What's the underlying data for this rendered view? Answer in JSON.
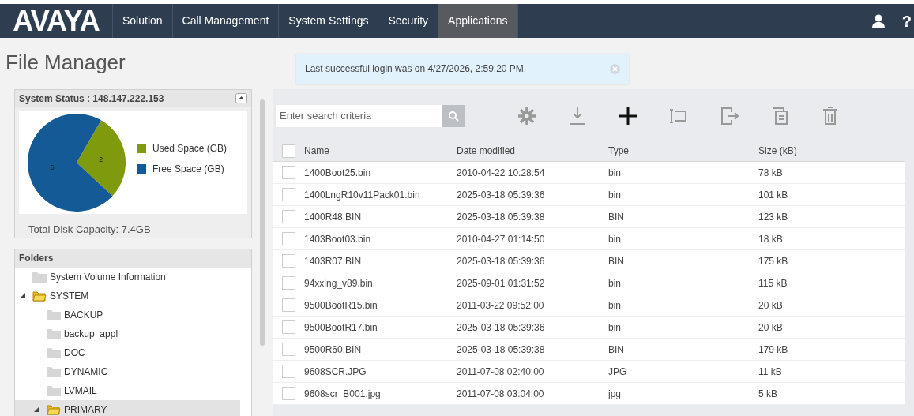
{
  "nav": {
    "logo": "AVAYA",
    "items": [
      {
        "label": "Solution",
        "selected": false
      },
      {
        "label": "Call Management",
        "selected": false
      },
      {
        "label": "System Settings",
        "selected": false
      },
      {
        "label": "Security",
        "selected": false
      },
      {
        "label": "Applications",
        "selected": true
      }
    ],
    "help": "?"
  },
  "page_title": "File Manager",
  "notification": "Last successful login was on 4/27/2026, 2:59:20 PM.",
  "status_panel": {
    "title": "System Status : 148.147.222.153",
    "legend": [
      {
        "color": "#7f9a0c"
      },
      {
        "color": "#135a96"
      }
    ],
    "chart_data": {
      "type": "pie",
      "categories": [
        "Used Space (GB)",
        "Free Space (GB)"
      ],
      "values": [
        2,
        5
      ],
      "data_labels": true
    },
    "total": "Total Disk Capacity: 7.4GB"
  },
  "folders": {
    "title": "Folders",
    "tree": [
      {
        "name": "System Volume Information",
        "expanded": false,
        "selected": false
      },
      {
        "name": "SYSTEM",
        "expanded": true,
        "selected": false,
        "children": [
          {
            "name": "BACKUP",
            "expanded": false,
            "selected": false
          },
          {
            "name": "backup_appl",
            "expanded": false,
            "selected": false
          },
          {
            "name": "DOC",
            "expanded": false,
            "selected": false
          },
          {
            "name": "DYNAMIC",
            "expanded": false,
            "selected": false
          },
          {
            "name": "LVMAIL",
            "expanded": false,
            "selected": false
          },
          {
            "name": "PRIMARY",
            "expanded": true,
            "selected": true
          }
        ]
      }
    ]
  },
  "search": {
    "placeholder": "Enter search criteria"
  },
  "table": {
    "select_all": {
      "checked": false
    },
    "columns": [
      "Name",
      "Date modified",
      "Type",
      "Size (kB)"
    ],
    "rows": [
      {
        "checked": false,
        "cells": [
          "1400Boot25.bin",
          "2010-04-22 10:28:54",
          "bin",
          "78 kB"
        ]
      },
      {
        "checked": false,
        "cells": [
          "1400LngR10v11Pack01.bin",
          "2025-03-18 05:39:36",
          "bin",
          "101 kB"
        ]
      },
      {
        "checked": false,
        "cells": [
          "1400R48.BIN",
          "2025-03-18 05:39:38",
          "BIN",
          "123 kB"
        ]
      },
      {
        "checked": false,
        "cells": [
          "1403Boot03.bin",
          "2010-04-27 01:14:50",
          "bin",
          "18 kB"
        ]
      },
      {
        "checked": false,
        "cells": [
          "1403R07.BIN",
          "2025-03-18 05:39:36",
          "BIN",
          "175 kB"
        ]
      },
      {
        "checked": false,
        "cells": [
          "94xxlng_v89.bin",
          "2025-09-01 01:31:52",
          "bin",
          "115 kB"
        ]
      },
      {
        "checked": false,
        "cells": [
          "9500BootR15.bin",
          "2011-03-22 09:52:00",
          "bin",
          "20 kB"
        ]
      },
      {
        "checked": false,
        "cells": [
          "9500BootR17.bin",
          "2025-03-18 05:39:36",
          "bin",
          "20 kB"
        ]
      },
      {
        "checked": false,
        "cells": [
          "9500R60.BIN",
          "2025-03-18 05:39:38",
          "BIN",
          "179 kB"
        ]
      },
      {
        "checked": false,
        "cells": [
          "9608SCR.JPG",
          "2011-07-08 02:40:00",
          "JPG",
          "11 kB"
        ]
      },
      {
        "checked": false,
        "cells": [
          "9608scr_B001.jpg",
          "2011-07-08 03:04:00",
          "jpg",
          "5 kB"
        ]
      }
    ]
  }
}
